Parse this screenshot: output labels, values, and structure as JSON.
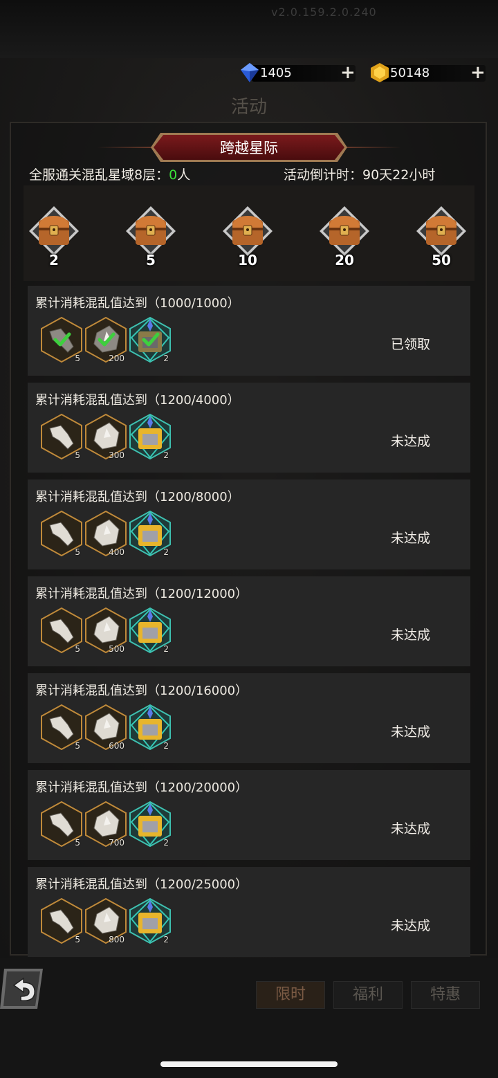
{
  "header": {
    "version_text": "v2.0.159.2.0.240",
    "title": "活动"
  },
  "resources": {
    "diamond": {
      "value": "1405",
      "icon": "blue-diamond-icon",
      "plus": "+"
    },
    "gold": {
      "value": "50148",
      "icon": "gold-gem-icon",
      "plus": "+"
    }
  },
  "event": {
    "name": "跨越星际",
    "clear_label": "全服通关混乱星域8层：",
    "clear_count": "0",
    "clear_unit": "人",
    "countdown": "活动倒计时：90天22小时"
  },
  "chest_milestones": [
    "2",
    "5",
    "10",
    "20",
    "50"
  ],
  "tasks": [
    {
      "requirement": "累计消耗混乱值达到（1000/1000）",
      "rewards": [
        "5",
        "200",
        "2"
      ],
      "status": "已领取",
      "claimed": true
    },
    {
      "requirement": "累计消耗混乱值达到（1200/4000）",
      "rewards": [
        "5",
        "300",
        "2"
      ],
      "status": "未达成",
      "claimed": false
    },
    {
      "requirement": "累计消耗混乱值达到（1200/8000）",
      "rewards": [
        "5",
        "400",
        "2"
      ],
      "status": "未达成",
      "claimed": false
    },
    {
      "requirement": "累计消耗混乱值达到（1200/12000）",
      "rewards": [
        "5",
        "500",
        "2"
      ],
      "status": "未达成",
      "claimed": false
    },
    {
      "requirement": "累计消耗混乱值达到（1200/16000）",
      "rewards": [
        "5",
        "600",
        "2"
      ],
      "status": "未达成",
      "claimed": false
    },
    {
      "requirement": "累计消耗混乱值达到（1200/20000）",
      "rewards": [
        "5",
        "700",
        "2"
      ],
      "status": "未达成",
      "claimed": false
    },
    {
      "requirement": "累计消耗混乱值达到（1200/25000）",
      "rewards": [
        "5",
        "800",
        "2"
      ],
      "status": "未达成",
      "claimed": false
    }
  ],
  "tabs": [
    {
      "label": "限时",
      "active": true
    },
    {
      "label": "福利",
      "active": false
    },
    {
      "label": "特惠",
      "active": false
    }
  ],
  "colors": {
    "banner_red": "#7a1a1c",
    "count_green": "#3be23b",
    "card_bg": "#262626",
    "check_green": "#3ecf3e"
  }
}
